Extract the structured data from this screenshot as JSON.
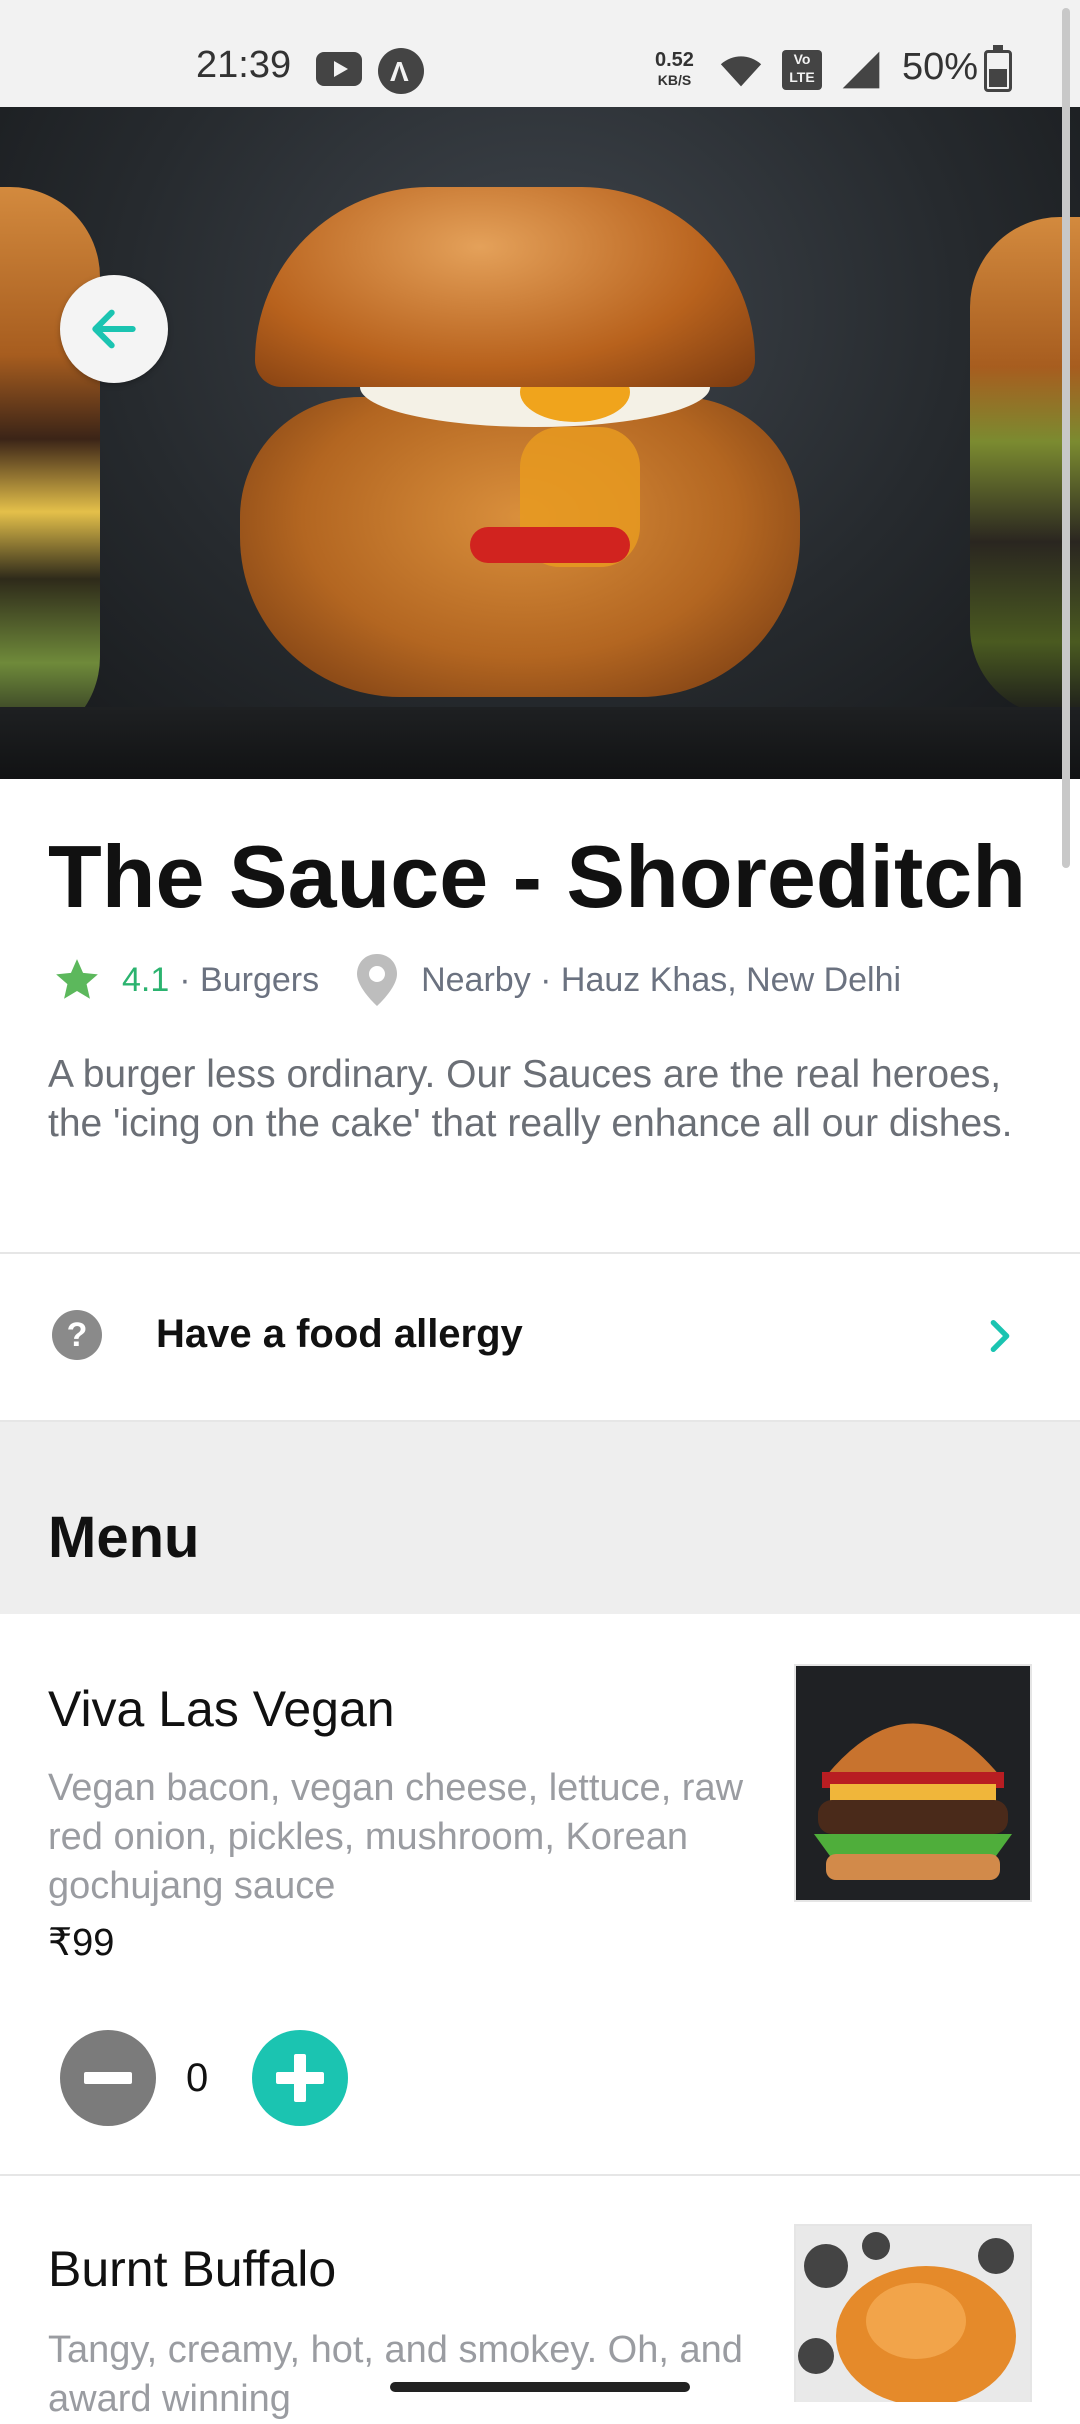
{
  "status_bar": {
    "time": "21:39",
    "net_speed_value": "0.52",
    "net_speed_unit": "KB/S",
    "volte": "Vo LTE",
    "battery": "50%"
  },
  "restaurant": {
    "name": "The Sauce - Shoreditch",
    "rating": "4.1",
    "cuisine": "· Burgers",
    "location": "Nearby · Hauz Khas, New Delhi",
    "description": "A burger less ordinary. Our Sauces are the real heroes, the 'icing on the cake' that really enhance all our dishes."
  },
  "allergy": {
    "label": "Have a food allergy"
  },
  "menu": {
    "heading": "Menu",
    "items": [
      {
        "name": "Viva Las Vegan",
        "description": "Vegan bacon, vegan cheese, lettuce, raw red onion, pickles, mushroom, Korean gochujang sauce",
        "price": "₹99",
        "quantity": "0"
      },
      {
        "name": "Burnt Buffalo",
        "description": "Tangy, creamy, hot, and smokey. Oh, and award winning"
      }
    ]
  },
  "colors": {
    "accent": "#1bc4b1",
    "rating_green": "#2bb36f",
    "section_bg": "#eeeeee"
  },
  "icons": {
    "back": "arrow-left-icon",
    "rating": "star-icon",
    "location": "map-pin-icon",
    "help": "question-circle-icon",
    "chevron": "chevron-right-icon"
  }
}
